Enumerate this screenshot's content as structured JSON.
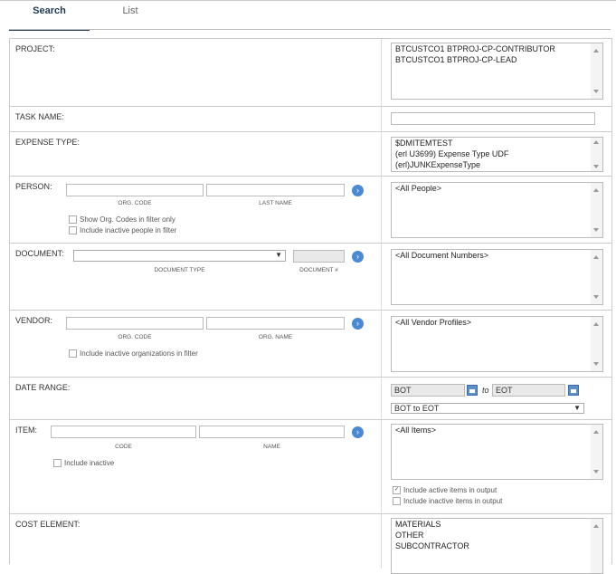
{
  "tabs": {
    "search": "Search",
    "list": "List"
  },
  "project": {
    "label": "PROJECT:",
    "items": [
      "BTCUSTCO1 BTPROJ-CP-CONTRIBUTOR",
      "BTCUSTCO1 BTPROJ-CP-LEAD"
    ]
  },
  "task": {
    "label": "TASK NAME:",
    "value": ""
  },
  "expense": {
    "label": "EXPENSE TYPE:",
    "items": [
      "$DMITEMTEST",
      "(erl U3699) Expense Type UDF",
      "(erl)JUNKExpenseType"
    ]
  },
  "person": {
    "label": "PERSON:",
    "org_code_cap": "ORG. CODE",
    "last_name_cap": "LAST NAME",
    "show_org": "Show Org. Codes in filter only",
    "include_inactive": "Include inactive people in filter",
    "items": [
      "<All People>"
    ]
  },
  "document": {
    "label": "DOCUMENT:",
    "type_cap": "DOCUMENT TYPE",
    "num_cap": "DOCUMENT #",
    "items": [
      "<All Document Numbers>"
    ]
  },
  "vendor": {
    "label": "VENDOR:",
    "org_code_cap": "ORG. CODE",
    "org_name_cap": "ORG. NAME",
    "include_inactive": "Include inactive organizations in filter",
    "items": [
      "<All Vendor Profiles>"
    ]
  },
  "date": {
    "label": "DATE RANGE:",
    "from": "BOT",
    "to_word": "to",
    "to": "EOT",
    "range": "BOT to EOT"
  },
  "item": {
    "label": "ITEM:",
    "code_cap": "CODE",
    "name_cap": "NAME",
    "include_inactive": "Include inactive",
    "items": [
      "<All Items>"
    ],
    "include_active_output": "Include active items in output",
    "include_inactive_output": "Include inactive items in output"
  },
  "cost": {
    "label": "COST ELEMENT:",
    "items": [
      "MATERIALS",
      "OTHER",
      "SUBCONTRACTOR"
    ]
  }
}
